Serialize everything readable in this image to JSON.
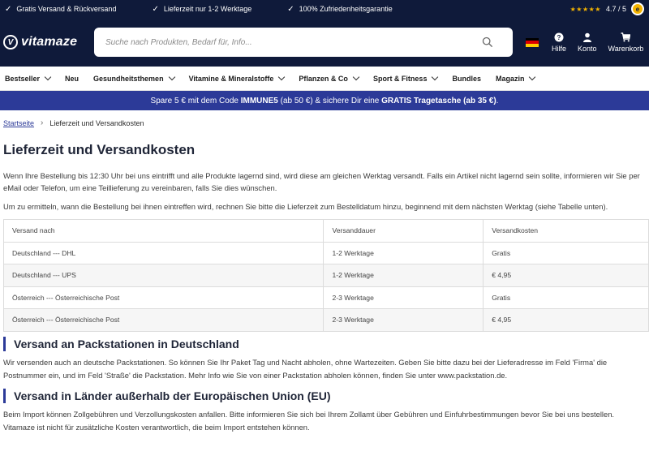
{
  "usp": [
    {
      "icon": "check-icon",
      "text": "Gratis Versand & Rückversand"
    },
    {
      "icon": "check-icon",
      "text": "Lieferzeit nur 1-2 Werktage"
    },
    {
      "icon": "check-icon",
      "text": "100% Zufriedenheitsgarantie"
    }
  ],
  "rating": {
    "stars": "★★★★★",
    "score": "4.7 / 5",
    "star_color": "#f4b400"
  },
  "header": {
    "logo_text": "vitamaze",
    "search_placeholder": "Suche nach Produkten, Bedarf für, Info...",
    "actions": [
      {
        "label": "Hilfe",
        "icon": "help-icon"
      },
      {
        "label": "Konto",
        "icon": "user-icon"
      },
      {
        "label": "Warenkorb",
        "icon": "cart-icon"
      }
    ],
    "bg_color": "#0f1a3a"
  },
  "nav": [
    {
      "label": "Bestseller",
      "dropdown": true
    },
    {
      "label": "Neu",
      "dropdown": false
    },
    {
      "label": "Gesundheitsthemen",
      "dropdown": true
    },
    {
      "label": "Vitamine & Mineralstoffe",
      "dropdown": true
    },
    {
      "label": "Pflanzen & Co",
      "dropdown": true
    },
    {
      "label": "Sport & Fitness",
      "dropdown": true
    },
    {
      "label": "Bundles",
      "dropdown": false
    },
    {
      "label": "Magazin",
      "dropdown": true
    }
  ],
  "promo": {
    "pre": "Spare 5 € mit dem Code ",
    "code": "IMMUNE5",
    "mid1": " (ab 50 €) & sichere Dir eine ",
    "gift": "GRATIS Tragetasche",
    "mid2": " ",
    "cond": "(ab 35 €)",
    "end": ".",
    "bg_color": "#2c3a98"
  },
  "breadcrumb": {
    "home": "Startseite",
    "current": "Lieferzeit und Versandkosten"
  },
  "page_title": "Lieferzeit und Versandkosten",
  "intro_1": "Wenn Ihre Bestellung bis 12:30 Uhr bei uns eintrifft und alle Produkte lagernd sind, wird diese am gleichen Werktag versandt. Falls ein Artikel nicht lagernd sein sollte, informieren wir Sie per eMail oder Telefon, um eine Teillieferung zu vereinbaren, falls Sie dies wünschen.",
  "intro_2": "Um zu ermitteln, wann die Bestellung bei ihnen eintreffen wird, rechnen Sie bitte die Lieferzeit zum Bestelldatum hinzu, beginnend mit dem nächsten Werktag (siehe Tabelle unten).",
  "table": {
    "headers": [
      "Versand nach",
      "Versanddauer",
      "Versandkosten"
    ],
    "rows": [
      [
        "Deutschland --- DHL",
        "1-2 Werktage",
        "Gratis"
      ],
      [
        "Deutschland --- UPS",
        "1-2 Werktage",
        "€ 4,95"
      ],
      [
        "Österreich --- Österreichische Post",
        "2-3 Werktage",
        "Gratis"
      ],
      [
        "Österreich --- Österreichische Post",
        "2-3 Werktage",
        "€ 4,95"
      ]
    ]
  },
  "section_packstation": {
    "title": "Versand an Packstationen in Deutschland",
    "text": "Wir versenden auch an deutsche Packstationen. So können Sie Ihr Paket Tag und Nacht abholen, ohne Wartezeiten. Geben Sie bitte dazu bei der Lieferadresse im Feld 'Firma' die Postnummer ein, und im Feld 'Straße' die Packstation. Mehr Info wie Sie von einer Packstation abholen können, finden Sie unter www.packstation.de."
  },
  "section_non_eu": {
    "title": "Versand in Länder außerhalb der Europäischen Union (EU)",
    "text": "Beim Import können Zollgebühren und Verzollungskosten anfallen. Bitte informieren Sie sich bei Ihrem Zollamt über Gebühren und Einfuhrbestimmungen bevor Sie bei uns bestellen. Vitamaze ist nicht für zusätzliche Kosten verantwortlich, die beim Import entstehen können."
  }
}
